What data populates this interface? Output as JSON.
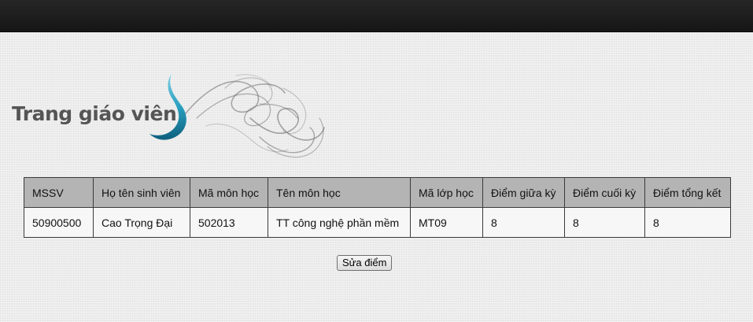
{
  "header": {
    "banner_title": "Trang giáo viên"
  },
  "grades_table": {
    "columns": [
      "MSSV",
      "Họ tên sinh viên",
      "Mã môn học",
      "Tên môn học",
      "Mã lớp học",
      "Điểm giữa kỳ",
      "Điểm cuối kỳ",
      "Điểm tổng kết"
    ],
    "rows": [
      [
        "50900500",
        "Cao Trọng Đại",
        "502013",
        "TT công nghệ phần mềm",
        "MT09",
        "8",
        "8",
        "8"
      ]
    ]
  },
  "actions": {
    "edit_label": "Sửa điểm"
  },
  "colors": {
    "topbar": "#1c1c1c",
    "accent_swoosh": "#2a9fbf",
    "header_cell": "#b4b4b4"
  }
}
